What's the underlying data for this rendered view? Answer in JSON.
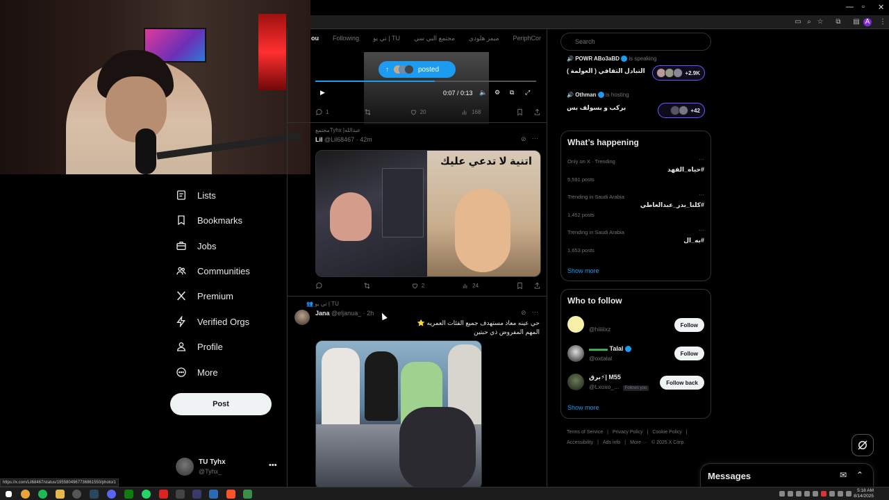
{
  "browser": {
    "toolbar_icons": [
      "cast-icon",
      "zoom-icon",
      "star-icon",
      "extensions-icon",
      "profile-icon"
    ],
    "profile_letter": "A"
  },
  "sidebar": {
    "items": [
      {
        "label": "Lists",
        "icon": "list-icon"
      },
      {
        "label": "Bookmarks",
        "icon": "bookmark-icon"
      },
      {
        "label": "Jobs",
        "icon": "briefcase-icon"
      },
      {
        "label": "Communities",
        "icon": "people-icon"
      },
      {
        "label": "Premium",
        "icon": "x-logo-icon"
      },
      {
        "label": "Verified Orgs",
        "icon": "lightning-icon"
      },
      {
        "label": "Profile",
        "icon": "person-icon"
      },
      {
        "label": "More",
        "icon": "more-circle-icon"
      }
    ],
    "post_label": "Post",
    "account": {
      "name": "TU Tyhx",
      "handle": "@Tyhx_",
      "more": "•••"
    }
  },
  "feed": {
    "tabs": [
      {
        "label": "ou",
        "active": true
      },
      {
        "label": "Following",
        "active": false
      },
      {
        "label": "تي يو | TU",
        "active": false
      },
      {
        "label": "مجتمع البي سي",
        "active": false
      },
      {
        "label": "ميمز هلودي",
        "active": false
      },
      {
        "label": "PeriphCor",
        "active": false
      }
    ],
    "video_post": {
      "posted_label": "posted",
      "time": "0:07 / 0:13",
      "progress": 0.54,
      "replies": "1",
      "reposts": "",
      "likes": "20",
      "views": "168"
    },
    "post1": {
      "context": "مجتمعTyhx |عبدالله",
      "name": "Lil",
      "handle": "@Lil68467",
      "time": "· 42m",
      "image_caption": "اتنية لا تدعي عليك",
      "replies": "",
      "reposts": "",
      "likes": "2",
      "views": "24"
    },
    "post2": {
      "context": "تي يو | TU",
      "name": "Jana",
      "handle": "@eljanua_",
      "time": "· 2h",
      "text_line1": "حي عينه معاذ مستهدف جميع الفئات العمريه ⭐",
      "text_line2": "المهم المفروض ذي حبتين"
    }
  },
  "right": {
    "search_placeholder": "Search",
    "spaces": [
      {
        "host": "POWR ABo3aBD",
        "status": "is speaking",
        "title": "التبادل الثقافي ( العولمة )",
        "count": "+2.9K"
      },
      {
        "host": "Othman",
        "status": "is hosting",
        "title": "بركب و بسولف بس",
        "count": "+42"
      }
    ],
    "happening": {
      "title": "What’s happening",
      "trends": [
        {
          "context": "Only on X · Trending",
          "name": "#حياه_الفهد",
          "posts": "5,591 posts"
        },
        {
          "context": "Trending in Saudi Arabia",
          "name": "#كلنا_بدر_عبدالعاطي",
          "posts": "1,452 posts"
        },
        {
          "context": "Trending in Saudi Arabia",
          "name": "#به_ال",
          "posts": "1,653 posts"
        }
      ],
      "more_dots": "···",
      "show_more": "Show more"
    },
    "follow": {
      "title": "Who to follow",
      "users": [
        {
          "name": "",
          "handle": "@hiiiiixz",
          "button": "Follow",
          "follows_you": ""
        },
        {
          "name": "Talal",
          "handle": "@oxtalal",
          "button": "Follow",
          "follows_you": ""
        },
        {
          "name": "برق⚡| M55",
          "handle": "@Lxoxo_...",
          "button": "Follow back",
          "follows_you": "Follows you"
        }
      ],
      "show_more": "Show more"
    },
    "footer": [
      "Terms of Service",
      "|",
      "Privacy Policy",
      "|",
      "Cookie Policy",
      "|",
      "Accessibility",
      "|",
      "Ads info",
      "|",
      "More ···",
      "© 2025 X Corp."
    ]
  },
  "messages": {
    "title": "Messages"
  },
  "status_url": "https://x.com/Lil68467/status/1955804967736861550/photo/1",
  "taskbar": {
    "time": "5:18 AM",
    "date": "8/14/2025"
  }
}
